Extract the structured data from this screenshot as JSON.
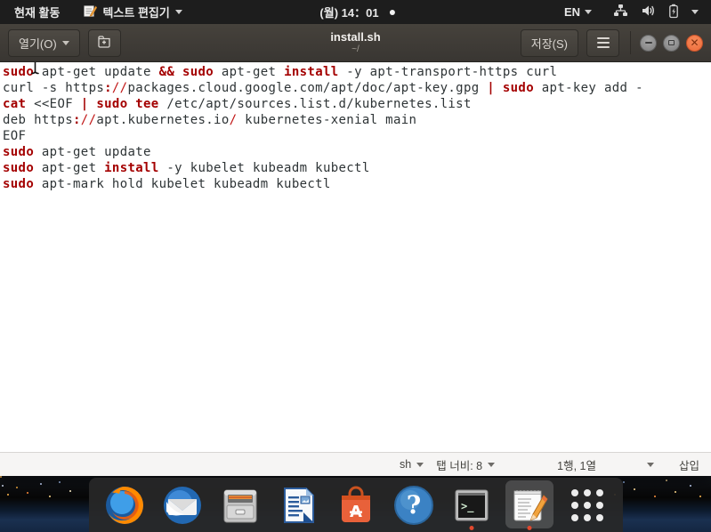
{
  "top_bar": {
    "activities_label": "현재 활동",
    "app_menu_label": "텍스트 편집기",
    "clock": "(월) 14：01",
    "keyboard_layout": "EN",
    "icons": [
      "gedit-icon",
      "network-wired-icon",
      "volume-icon",
      "battery-charging-icon",
      "caret-down-icon"
    ],
    "notification_dot": true
  },
  "header_bar": {
    "open_button_label": "열기(O)",
    "new_tab_button_icon": "new-document-icon",
    "title": "install.sh",
    "subtitle": "~/",
    "save_button_label": "저장(S)",
    "menu_button_icon": "hamburger-menu-icon",
    "window_controls": [
      "minimize",
      "maximize",
      "close"
    ],
    "close_button_color": "#ed6a39"
  },
  "editor": {
    "syntax_colors": {
      "keyword": "#a40000",
      "operator_red": "#c01414",
      "text": "#2e3436",
      "background": "#ffffff"
    },
    "lines": [
      [
        {
          "t": "sudo",
          "s": "k"
        },
        {
          "t": " apt-get update ",
          "s": ""
        },
        {
          "t": "&&",
          "s": "k"
        },
        {
          "t": " ",
          "s": ""
        },
        {
          "t": "sudo",
          "s": "k"
        },
        {
          "t": " apt-get ",
          "s": ""
        },
        {
          "t": "install",
          "s": "k"
        },
        {
          "t": " -y apt-transport-https curl",
          "s": ""
        }
      ],
      [
        {
          "t": "curl -s https",
          "s": ""
        },
        {
          "t": ":",
          "s": "k"
        },
        {
          "t": "//",
          "s": "r"
        },
        {
          "t": "packages.cloud.google.com/apt/doc/apt-key.gpg ",
          "s": ""
        },
        {
          "t": "|",
          "s": "k"
        },
        {
          "t": " ",
          "s": ""
        },
        {
          "t": "sudo",
          "s": "k"
        },
        {
          "t": " apt-key add -",
          "s": ""
        }
      ],
      [
        {
          "t": "cat",
          "s": "k"
        },
        {
          "t": " <<EOF ",
          "s": ""
        },
        {
          "t": "|",
          "s": "k"
        },
        {
          "t": " ",
          "s": ""
        },
        {
          "t": "sudo tee",
          "s": "k"
        },
        {
          "t": " /etc/apt/sources.list.d/kubernetes.list",
          "s": ""
        }
      ],
      [
        {
          "t": "deb https",
          "s": ""
        },
        {
          "t": ":",
          "s": "k"
        },
        {
          "t": "//",
          "s": "r"
        },
        {
          "t": "apt.kubernetes.io",
          "s": ""
        },
        {
          "t": "/",
          "s": "r"
        },
        {
          "t": " kubernetes-xenial main",
          "s": ""
        }
      ],
      [
        {
          "t": "EOF",
          "s": ""
        }
      ],
      [
        {
          "t": "sudo",
          "s": "k"
        },
        {
          "t": " apt-get update",
          "s": ""
        }
      ],
      [
        {
          "t": "sudo",
          "s": "k"
        },
        {
          "t": " apt-get ",
          "s": ""
        },
        {
          "t": "install",
          "s": "k"
        },
        {
          "t": " -y kubelet kubeadm kubectl",
          "s": ""
        }
      ],
      [
        {
          "t": "sudo",
          "s": "k"
        },
        {
          "t": " apt-mark hold kubelet kubeadm kubectl",
          "s": ""
        }
      ]
    ]
  },
  "status_bar": {
    "language": "sh",
    "tab_width_label": "탭 너비: 8",
    "cursor_position": "1행, 1열",
    "insert_mode": "삽입"
  },
  "dock": {
    "items": [
      {
        "name": "firefox",
        "running": false,
        "active": false
      },
      {
        "name": "thunderbird",
        "running": false,
        "active": false
      },
      {
        "name": "files",
        "running": false,
        "active": false
      },
      {
        "name": "libreoffice-writer",
        "running": false,
        "active": false
      },
      {
        "name": "ubuntu-software",
        "running": false,
        "active": false
      },
      {
        "name": "help",
        "running": false,
        "active": false
      },
      {
        "name": "terminal",
        "running": true,
        "active": false
      },
      {
        "name": "gedit",
        "running": true,
        "active": true
      },
      {
        "name": "app-grid",
        "running": false,
        "active": false
      }
    ],
    "running_dot_color": "#e0482e"
  }
}
